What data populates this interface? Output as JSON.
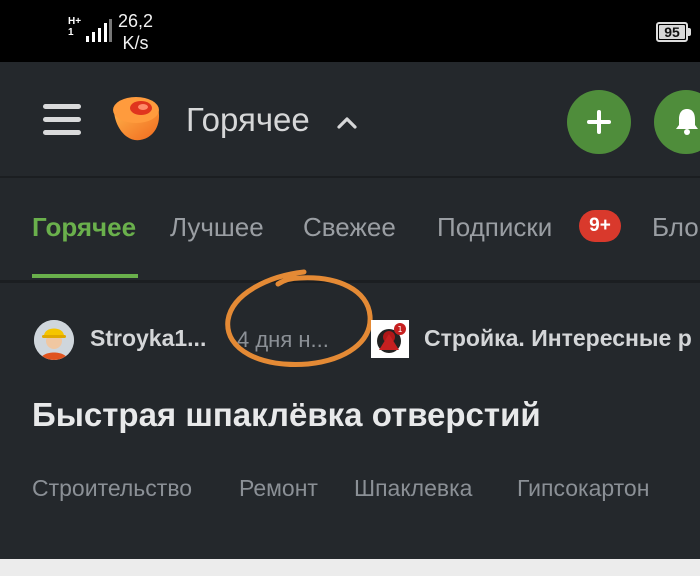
{
  "status_bar": {
    "network_type": "H+",
    "sim_slot": "1",
    "speed_value": "26,2",
    "speed_unit": "K/s",
    "battery": "95"
  },
  "header": {
    "title": "Горячее",
    "menu_icon": "hamburger-icon",
    "logo_icon": "pikabu-logo",
    "chevron_icon": "chevron-up-icon",
    "add_icon": "plus-icon",
    "bell_icon": "bell-icon",
    "accent_color": "#4f8d3b"
  },
  "tabs": {
    "items": [
      {
        "label": "Горячее",
        "active": true
      },
      {
        "label": "Лучшее",
        "active": false
      },
      {
        "label": "Свежее",
        "active": false
      },
      {
        "label": "Подписки",
        "active": false
      },
      {
        "label": "Бло",
        "active": false
      }
    ],
    "subscriptions_badge": "9+",
    "active_color": "#6ab04c",
    "badge_color": "#d9392c"
  },
  "post": {
    "author": "Stroyka1...",
    "time": "4 дня н...",
    "community": "Стройка. Интересные р",
    "title": "Быстрая шпаклёвка отверстий",
    "tags": [
      "Строительство",
      "Ремонт",
      "Шпаклевка",
      "Гипсокартон"
    ],
    "annotation_color": "#e48a35"
  }
}
